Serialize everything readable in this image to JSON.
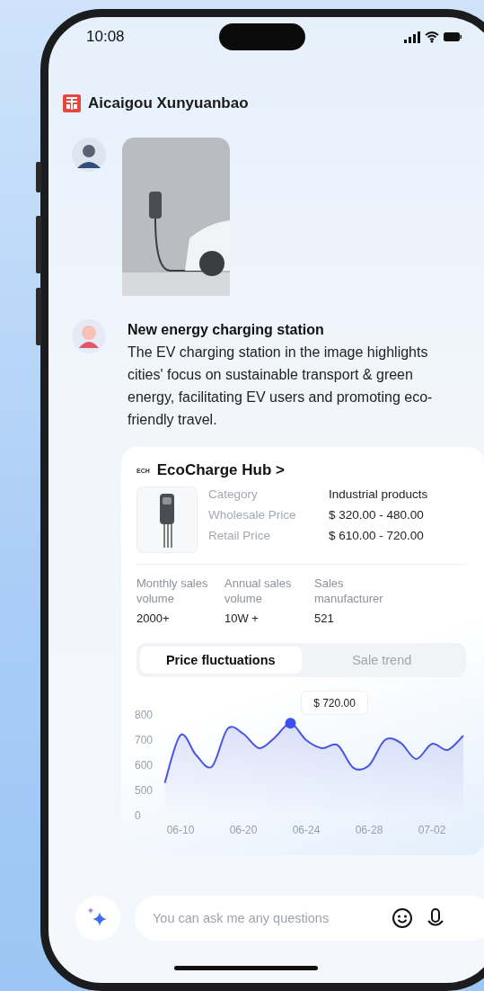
{
  "status_bar": {
    "time": "10:08"
  },
  "header": {
    "title": "Aicaigou Xunyuanbao"
  },
  "messages": [
    {
      "kind": "user-image"
    },
    {
      "kind": "bot-reply",
      "title": "New energy charging station",
      "text": "The EV charging station in the image highlights cities' focus on sustainable transport & green energy, facilitating EV users and promoting eco-friendly travel.",
      "product_card": {
        "logo": "ECH",
        "name": "EcoCharge Hub",
        "chevron": ">",
        "specs": [
          {
            "label": "Category",
            "value": "Industrial products"
          },
          {
            "label": "Wholesale Price",
            "value": "$ 320.00 - 480.00"
          },
          {
            "label": "Retail Price",
            "value": "$ 610.00 - 720.00"
          }
        ],
        "stats": [
          {
            "label": "Monthly sales volume",
            "value": "2000+"
          },
          {
            "label": "Annual sales volume",
            "value": "10W +"
          },
          {
            "label": "Sales manufacturer",
            "value": "521"
          }
        ],
        "tabs": [
          {
            "label": "Price fluctuations",
            "selected": true
          },
          {
            "label": "Sale trend",
            "selected": false
          }
        ],
        "chart_data": {
          "type": "area",
          "categories": [
            null,
            "06-10",
            null,
            null,
            null,
            "06-20",
            null,
            null,
            null,
            "06-24",
            null,
            null,
            null,
            "06-28",
            null,
            null,
            null,
            "07-02",
            null,
            null
          ],
          "series": [
            {
              "color": "#4a56e2",
              "values": [
                530,
                720,
                640,
                595,
                745,
                725,
                668,
                710,
                767,
                700,
                668,
                680,
                590,
                600,
                700,
                690,
                625,
                685,
                661,
                718
              ]
            }
          ],
          "yticks": [
            500,
            600,
            700,
            800
          ],
          "ylim": [
            500,
            800
          ],
          "annotations": [
            "$ 720.00"
          ]
        },
        "chart_baseline_label": "0"
      }
    }
  ],
  "input": {
    "placeholder": "You can ask me any questions"
  }
}
